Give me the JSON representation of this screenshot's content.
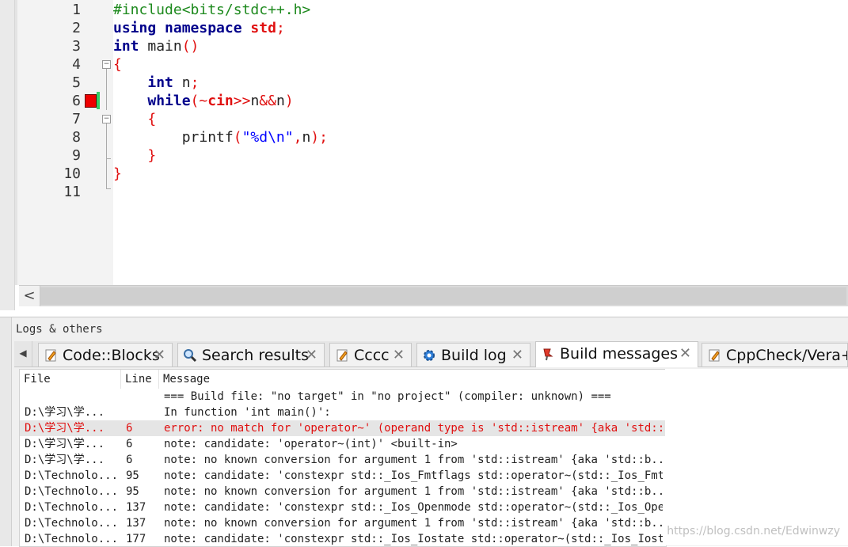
{
  "editor": {
    "line_numbers": [
      "1",
      "2",
      "3",
      "4",
      "5",
      "6",
      "7",
      "8",
      "9",
      "10",
      "11"
    ],
    "code": {
      "l1": "#include<bits/stdc++.h>",
      "l2_kw1": "using",
      "l2_kw2": "namespace",
      "l2_id": "std",
      "l2_semi": ";",
      "l3_kw": "int",
      "l3_rest": " main",
      "l3_paren": "()",
      "l4": "{",
      "l5_kw": "int",
      "l5_rest": " n",
      "l5_semi": ";",
      "l6_kw": "while",
      "l6_open": "(~",
      "l6_cin": "cin",
      "l6_op": ">>",
      "l6_n": "n",
      "l6_and": "&&",
      "l6_n2": "n",
      "l6_close": ")",
      "l7": "{",
      "l8_fn": "printf",
      "l8_open": "(",
      "l8_str": "\"%d\\n\"",
      "l8_comma": ",",
      "l8_n": "n",
      "l8_close": ");",
      "l9": "}",
      "l10": "}"
    },
    "scroll_left": "<"
  },
  "panel": {
    "title": "Logs & others",
    "tab_scroll": "◀",
    "tabs": [
      {
        "label": "Code::Blocks",
        "icon": "pencil-icon",
        "close": "✕"
      },
      {
        "label": "Search results",
        "icon": "magnifier-icon",
        "close": "✕"
      },
      {
        "label": "Cccc",
        "icon": "pencil-icon",
        "close": "✕"
      },
      {
        "label": "Build log",
        "icon": "gear-icon",
        "close": "✕"
      },
      {
        "label": "Build messages",
        "icon": "pin-icon",
        "close": "✕"
      },
      {
        "label": "CppCheck/Vera++",
        "icon": "pencil-icon",
        "close": ""
      }
    ],
    "active_tab": "Build messages"
  },
  "messages": {
    "headers": {
      "file": "File",
      "line": "Line",
      "message": "Message"
    },
    "rows": [
      {
        "file": "",
        "line": "",
        "message": "=== Build file: \"no target\" in \"no project\" (compiler: unknown) ==="
      },
      {
        "file": "D:\\学习\\学...",
        "line": "",
        "message": "In function 'int main()':"
      },
      {
        "file": "D:\\学习\\学...",
        "line": "6",
        "message": "error: no match for 'operator~' (operand type is 'std::istream' {aka 'std::...",
        "error": true
      },
      {
        "file": "D:\\学习\\学...",
        "line": "6",
        "message": "note: candidate: 'operator~(int)' <built-in>"
      },
      {
        "file": "D:\\学习\\学...",
        "line": "6",
        "message": "note:   no known conversion for argument 1 from 'std::istream' {aka 'std::b..."
      },
      {
        "file": "D:\\Technolo...",
        "line": "95",
        "message": "note: candidate: 'constexpr std::_Ios_Fmtflags std::operator~(std::_Ios_Fmt..."
      },
      {
        "file": "D:\\Technolo...",
        "line": "95",
        "message": "note:   no known conversion for argument 1 from 'std::istream' {aka 'std::b..."
      },
      {
        "file": "D:\\Technolo...",
        "line": "137",
        "message": "note: candidate: 'constexpr std::_Ios_Openmode std::operator~(std::_Ios_Ope..."
      },
      {
        "file": "D:\\Technolo...",
        "line": "137",
        "message": "note:   no known conversion for argument 1 from 'std::istream' {aka 'std::b..."
      },
      {
        "file": "D:\\Technolo...",
        "line": "177",
        "message": "note: candidate: 'constexpr std::_Ios_Iostate std::operator~(std::_Ios_Iost..."
      }
    ]
  },
  "watermark": "https://blog.csdn.net/Edwinwzy"
}
